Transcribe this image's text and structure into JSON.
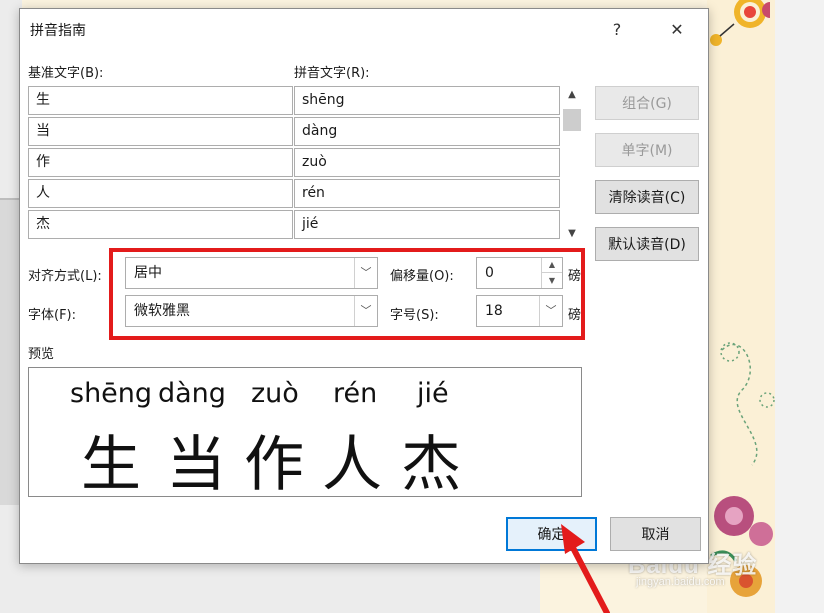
{
  "dialog": {
    "title": "拼音指南",
    "help_label": "?",
    "close_label": "✕"
  },
  "columns": {
    "base_label": "基准文字(B):",
    "ruby_label": "拼音文字(R):"
  },
  "rows": [
    {
      "base": "生",
      "ruby": "shēng"
    },
    {
      "base": "当",
      "ruby": "dàng"
    },
    {
      "base": "作",
      "ruby": "zuò"
    },
    {
      "base": "人",
      "ruby": "rén"
    },
    {
      "base": "杰",
      "ruby": "jié"
    }
  ],
  "side_buttons": {
    "group": "组合(G)",
    "mono": "单字(M)",
    "clear": "清除读音(C)",
    "default_reading": "默认读音(D)"
  },
  "options": {
    "alignment_label": "对齐方式(L):",
    "alignment_value": "居中",
    "offset_label": "偏移量(O):",
    "offset_value": "0",
    "offset_unit": "磅",
    "font_label": "字体(F):",
    "font_value": "微软雅黑",
    "size_label": "字号(S):",
    "size_value": "18",
    "size_unit": "磅"
  },
  "preview": {
    "label": "预览",
    "pinyin": [
      "shēng",
      "dàng",
      "zuò",
      "rén",
      "jié"
    ],
    "characters": [
      "生",
      "当",
      "作",
      "人",
      "杰"
    ]
  },
  "footer": {
    "ok": "确定",
    "cancel": "取消"
  },
  "watermark": {
    "brand": "Baidu 经验",
    "url": "jingyan.baidu.com"
  },
  "colors": {
    "highlight": "#e31b1b",
    "primary_border": "#0078d7"
  },
  "icons": [
    "help-icon",
    "close-icon",
    "scroll-up-icon",
    "scroll-down-icon",
    "chevron-down-icon",
    "red-arrow-pointer"
  ]
}
